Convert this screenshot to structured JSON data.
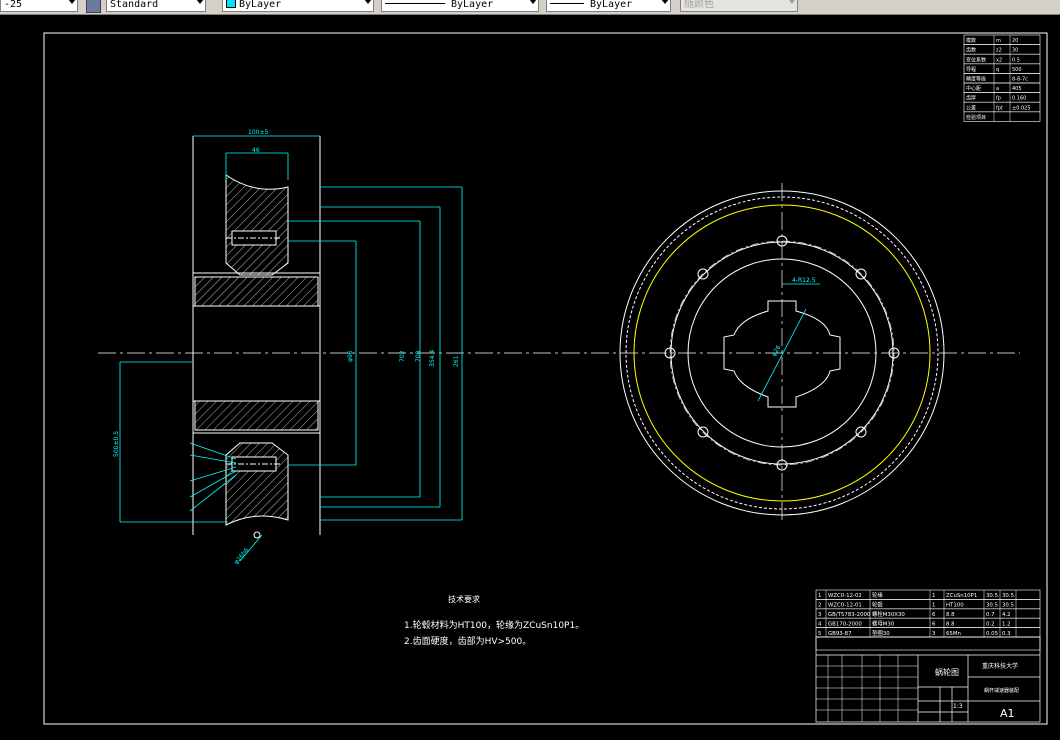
{
  "toolbar": {
    "dimstyle_scale": "-25",
    "text_style": "Standard",
    "layer": "ByLayer",
    "linetype": "ByLayer",
    "lineweight": "ByLayer",
    "plot_style": "随颜色"
  },
  "colors": {
    "background": "#000000",
    "lines": "#ffffff",
    "dimension": "#00ffff",
    "hidden_yellow": "#ffff00",
    "centerline": "#ffffff"
  },
  "drawing": {
    "left_view": {
      "dim_top_outer": "100±5",
      "dim_top_inner": "46",
      "dim_diam_1": "φ96",
      "dim_diam_2": "702",
      "dim_diam_3": "708",
      "dim_diam_4": "354.4",
      "dim_diam_5": "261",
      "dim_left": "500±0.5",
      "dim_bottom": "φ26h6"
    },
    "right_view": {
      "dim_radius": "4-R12.5",
      "dim_center": "φ26"
    },
    "tech_req": {
      "title": "技术要求",
      "line1": "1.轮毂材料为HT100，轮缘为ZCuSn10P1。",
      "line2": "2.齿面硬度，齿部为HV>500。"
    },
    "param_table": [
      [
        "模数",
        "m",
        "20"
      ],
      [
        "齿数",
        "z2",
        "30"
      ],
      [
        "变位系数",
        "x2",
        "0.5"
      ],
      [
        "导程",
        "q",
        "500"
      ],
      [
        "精度等级",
        "",
        "8-8-7c"
      ],
      [
        "中心距",
        "a",
        "405"
      ],
      [
        "齿厚",
        "fp",
        "0.160"
      ],
      [
        "公差",
        "fpt",
        "±0.025"
      ],
      [
        "检验项目",
        "",
        ""
      ]
    ],
    "parts_list": [
      [
        "5",
        "GB93-87",
        "垫圈30",
        "3",
        "65Mn",
        "0.05",
        "0.3"
      ],
      [
        "4",
        "GB170-2000",
        "螺母M30",
        "6",
        "8.8",
        "0.2",
        "1.2"
      ],
      [
        "3",
        "GB/T5783-2000",
        "螺栓M30X30",
        "6",
        "8.8",
        "0.7",
        "4.2"
      ],
      [
        "2",
        "WZC0-12-01",
        "轮毂",
        "1",
        "HT100",
        "30.5",
        "30.5"
      ],
      [
        "1",
        "WZC0-12-02",
        "轮缘",
        "1",
        "ZCuSn10P1",
        "30.5",
        "30.5"
      ]
    ],
    "title_block": {
      "drawing_name": "蜗轮图",
      "school": "重庆科技大学",
      "sheet_size": "A1",
      "scale": "1:3",
      "project": "蜗杆减速器装配"
    }
  }
}
